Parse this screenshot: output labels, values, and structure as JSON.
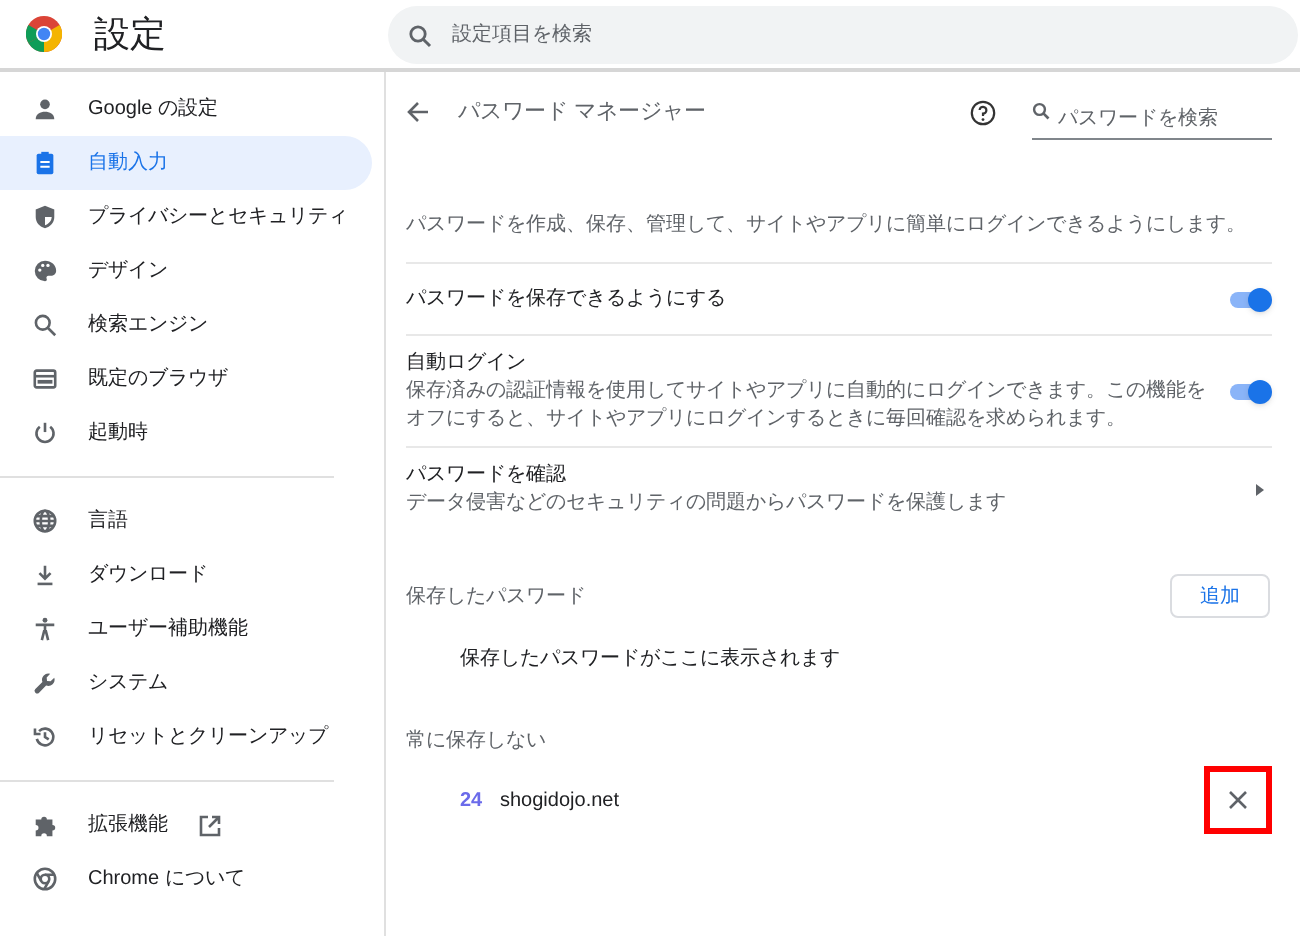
{
  "header": {
    "title": "設定",
    "search": {
      "placeholder": "設定項目を検索"
    }
  },
  "sidebar": {
    "groups": [
      [
        {
          "label": "Google の設定",
          "selected": false
        },
        {
          "label": "自動入力",
          "selected": true
        },
        {
          "label": "プライバシーとセキュリティ",
          "selected": false
        },
        {
          "label": "デザイン",
          "selected": false
        },
        {
          "label": "検索エンジン",
          "selected": false
        },
        {
          "label": "既定のブラウザ",
          "selected": false
        },
        {
          "label": "起動時",
          "selected": false
        }
      ],
      [
        {
          "label": "言語",
          "selected": false
        },
        {
          "label": "ダウンロード",
          "selected": false
        },
        {
          "label": "ユーザー補助機能",
          "selected": false
        },
        {
          "label": "システム",
          "selected": false
        },
        {
          "label": "リセットとクリーンアップ",
          "selected": false
        }
      ],
      [
        {
          "label": "拡張機能",
          "selected": false,
          "external": true
        },
        {
          "label": "Chrome について",
          "selected": false
        }
      ]
    ]
  },
  "page": {
    "title": "パスワード マネージャー",
    "search": {
      "placeholder": "パスワードを検索"
    },
    "description": "パスワードを作成、保存、管理して、サイトやアプリに簡単にログインできるようにします。",
    "settings": [
      {
        "kind": "toggle",
        "label": "パスワードを保存できるようにする",
        "on": true
      },
      {
        "kind": "toggle",
        "label": "自動ログイン",
        "sublabel": "保存済みの認証情報を使用してサイトやアプリに自動的にログインできます。この機能をオフにすると、サイトやアプリにログインするときに毎回確認を求められます。",
        "on": true
      },
      {
        "kind": "link",
        "label": "パスワードを確認",
        "sublabel": "データ侵害などのセキュリティの問題からパスワードを保護します"
      }
    ],
    "saved": {
      "heading": "保存したパスワード",
      "add_button": "追加",
      "empty_text": "保存したパスワードがここに表示されます"
    },
    "never_saved": {
      "heading": "常に保存しない",
      "sites": [
        {
          "badge": "24",
          "site": "shogidojo.net",
          "highlighted": true
        }
      ]
    }
  }
}
